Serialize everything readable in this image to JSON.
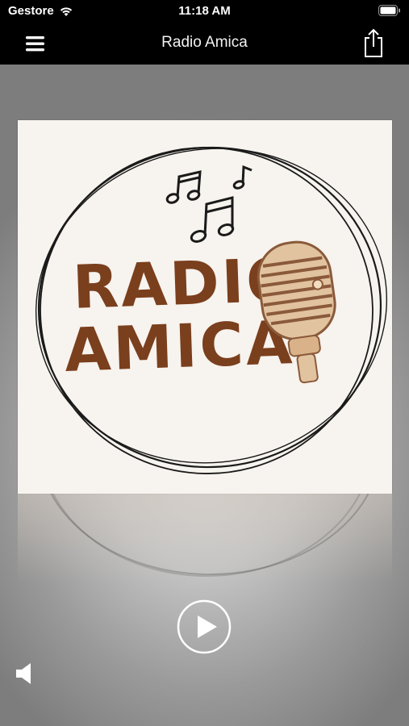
{
  "status_bar": {
    "carrier": "Gestore",
    "time": "11:18 AM",
    "wifi_icon": "wifi-icon",
    "battery_icon": "battery-icon"
  },
  "nav_bar": {
    "title": "Radio Amica",
    "menu_icon": "hamburger-menu-icon",
    "share_icon": "share-icon"
  },
  "artwork": {
    "line1": "RADIO",
    "line2": "AMICA",
    "text_color": "#7a3f1d",
    "background_color": "#f7f3ee"
  },
  "player": {
    "play_icon": "play-icon",
    "volume_icon": "volume-icon",
    "state": "paused"
  }
}
